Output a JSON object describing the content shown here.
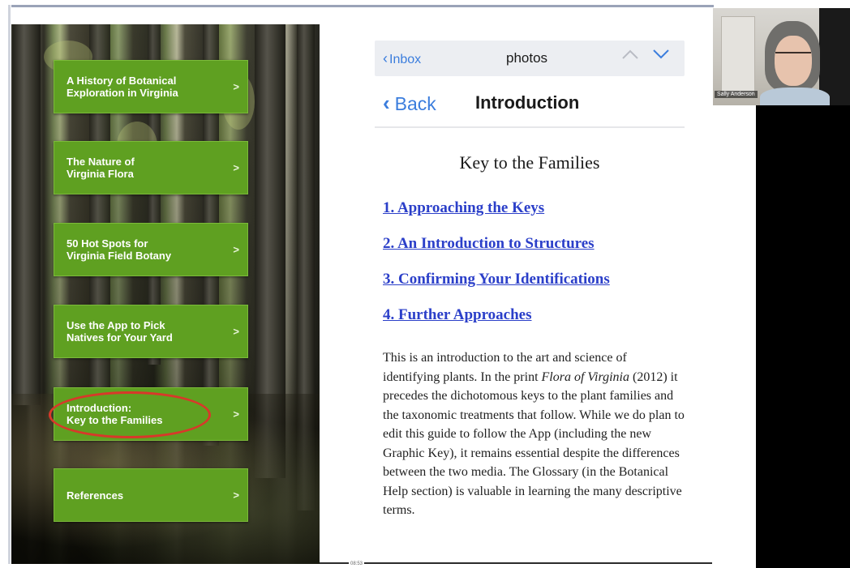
{
  "left_menu": {
    "items": [
      {
        "label": "A History of Botanical\nExploration in Virginia",
        "chevron": ">"
      },
      {
        "label": "The Nature of\nVirginia Flora",
        "chevron": ">"
      },
      {
        "label": "50 Hot Spots for\nVirginia Field Botany",
        "chevron": ">"
      },
      {
        "label": "Use the App to Pick\nNatives for Your Yard",
        "chevron": ">"
      },
      {
        "label": "Introduction:\nKey to the Families",
        "chevron": ">"
      },
      {
        "label": "References",
        "chevron": ">"
      }
    ],
    "highlight_color": "#d8382a",
    "button_color": "#5fa021"
  },
  "mail_bar": {
    "back_label": "Inbox",
    "title": "photos",
    "up_icon": "chevron-up-icon",
    "down_icon": "chevron-down-icon"
  },
  "nav": {
    "back_label": "Back",
    "title": "Introduction"
  },
  "document": {
    "title": "Key to the Families",
    "links": [
      "1. Approaching the Keys",
      "2. An Introduction to Structures",
      "3. Confirming Your Identifications",
      "4. Further Approaches"
    ],
    "body_part1": "This is an introduction to the art and science of identifying plants. In the print ",
    "body_italic": "Flora of Virginia",
    "body_part2": " (2012) it precedes the dichotomous keys to the plant families and the taxonomic treatments that follow. While we do plan to edit this guide to follow the App (including the new Graphic Key), it remains essential despite the differences between the two media. The Glossary (in the Botanical Help section) is valuable in learning the many descriptive terms."
  },
  "webcam": {
    "participant_name": "Sally Anderson"
  },
  "footer": {
    "timestamp": "08:53"
  },
  "colors": {
    "link_blue": "#2b3fc9",
    "ios_blue": "#3b7ddd"
  }
}
